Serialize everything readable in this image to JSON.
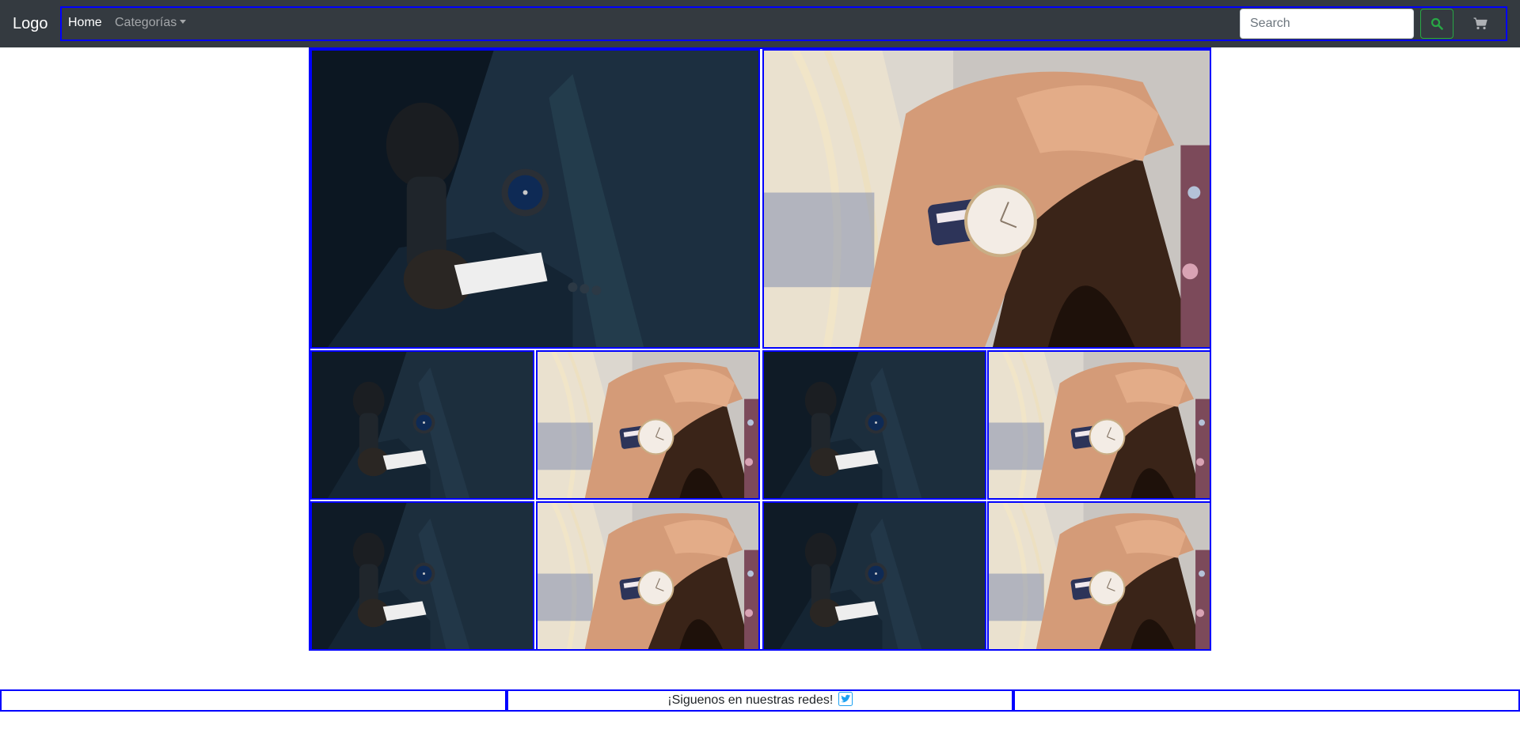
{
  "navbar": {
    "brand": "Logo",
    "home_label": "Home",
    "categories_label": "Categorías",
    "search_placeholder": "Search",
    "search_icon": "search-icon",
    "cart_icon": "cart-icon"
  },
  "gallery": {
    "images": [
      {
        "subject": "man-suit-watch"
      },
      {
        "subject": "woman-wrist-watch"
      },
      {
        "subject": "man-suit-watch"
      },
      {
        "subject": "woman-wrist-watch"
      },
      {
        "subject": "man-suit-watch"
      },
      {
        "subject": "woman-wrist-watch"
      },
      {
        "subject": "man-suit-watch"
      },
      {
        "subject": "woman-wrist-watch"
      },
      {
        "subject": "man-suit-watch"
      },
      {
        "subject": "woman-wrist-watch"
      }
    ]
  },
  "footer": {
    "social_text": "¡Siguenos en nuestras redes!",
    "social_icon": "twitter-icon"
  },
  "colors": {
    "navbar_bg": "#343a40",
    "outline": "#0000ff",
    "search_button_border": "#28a745",
    "twitter_blue": "#1da1f2"
  }
}
